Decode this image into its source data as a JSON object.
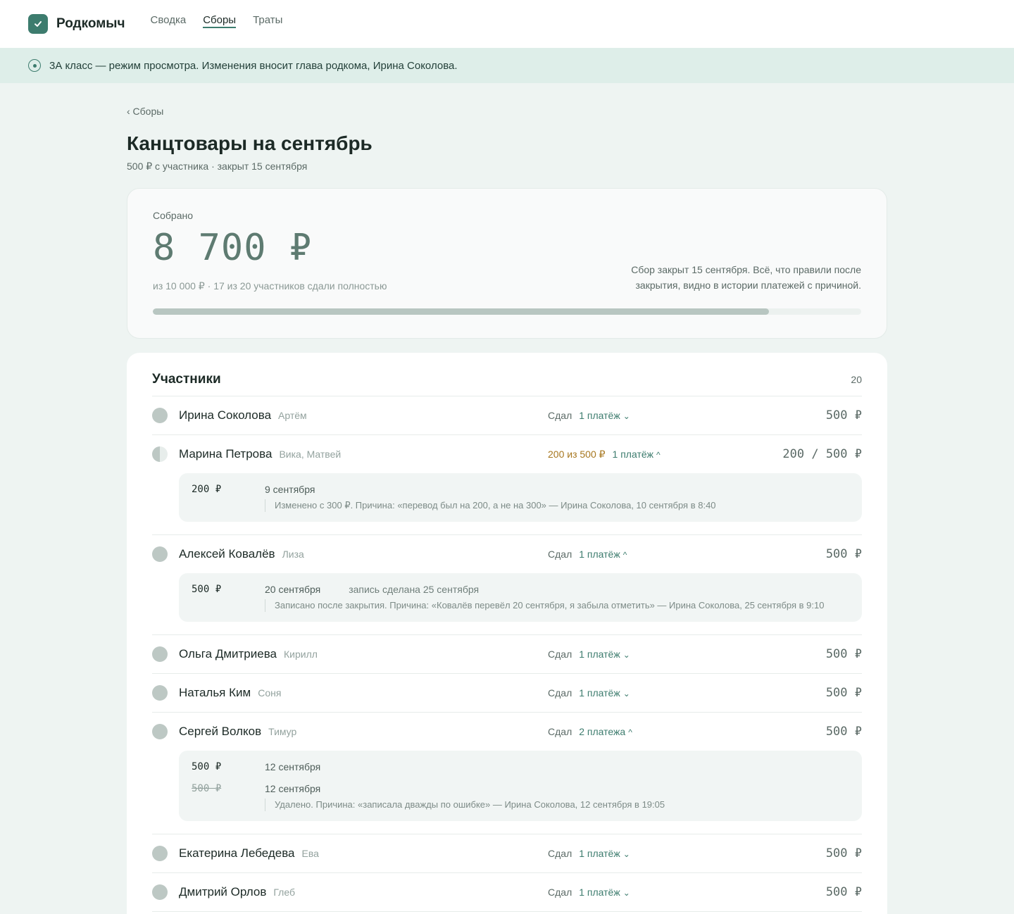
{
  "app": {
    "brand": "Родкомыч",
    "nav": [
      {
        "label": "Сводка",
        "active": false
      },
      {
        "label": "Сборы",
        "active": true
      },
      {
        "label": "Траты",
        "active": false
      }
    ]
  },
  "banner": {
    "text": "3А класс — режим просмотра. Изменения вносит глава родкома, Ирина Соколова."
  },
  "page": {
    "back_label": "‹ Сборы",
    "title": "Канцтовары на сентябрь",
    "subtitle": "500 ₽ с участника · закрыт 15 сентября"
  },
  "summary": {
    "label": "Собрано",
    "amount": "8 700 ₽",
    "sub": "из 10 000 ₽ · 17 из 20 участников сдали полностью",
    "note": "Сбор закрыт 15 сентября. Всё, что правили после закрытия, видно в истории платежей с причиной.",
    "progress": 0.87
  },
  "participants": {
    "title": "Участники",
    "count": "20",
    "rows": [
      {
        "name": "Ирина Соколова",
        "kids": "Артём",
        "status": "Сдал",
        "payments": "1 платёж",
        "chevron": "⌄",
        "amount": "500 ₽"
      },
      {
        "name": "Марина Петрова",
        "kids": "Вика, Матвей",
        "status": "200 из 500 ₽",
        "payments": "1 платёж",
        "chevron": "^",
        "amount": "200 / 500 ₽",
        "details": [
          {
            "amount": "200 ₽",
            "date": "9 сентября",
            "note": "Изменено с 300 ₽. Причина: «перевод был на 200, а не на 300» — Ирина Соколова, 10 сентября в 8:40"
          }
        ]
      },
      {
        "name": "Алексей Ковалёв",
        "kids": "Лиза",
        "status": "Сдал",
        "payments": "1 платёж",
        "chevron": "^",
        "amount": "500 ₽",
        "details": [
          {
            "amount": "500 ₽",
            "date": "20 сентября",
            "extra": "запись сделана 25 сентября",
            "note": "Записано после закрытия. Причина: «Ковалёв перевёл 20 сентября, я забыла отметить» — Ирина Соколова, 25 сентября в 9:10"
          }
        ]
      },
      {
        "name": "Ольга Дмитриева",
        "kids": "Кирилл",
        "status": "Сдал",
        "payments": "1 платёж",
        "chevron": "⌄",
        "amount": "500 ₽"
      },
      {
        "name": "Наталья Ким",
        "kids": "Соня",
        "status": "Сдал",
        "payments": "1 платёж",
        "chevron": "⌄",
        "amount": "500 ₽"
      },
      {
        "name": "Сергей Волков",
        "kids": "Тимур",
        "status": "Сдал",
        "payments": "2 платежа",
        "chevron": "^",
        "amount": "500 ₽",
        "details": [
          {
            "amount": "500 ₽",
            "date": "12 сентября"
          },
          {
            "amount": "500 ₽",
            "date": "12 сентября",
            "note": "Удалено. Причина: «записала дважды по ошибке» — Ирина Соколова, 12 сентября в 19:05"
          }
        ]
      },
      {
        "name": "Екатерина Лебедева",
        "kids": "Ева",
        "status": "Сдал",
        "payments": "1 платёж",
        "chevron": "⌄",
        "amount": "500 ₽"
      },
      {
        "name": "Дмитрий Орлов",
        "kids": "Глеб",
        "status": "Сдал",
        "payments": "1 платёж",
        "chevron": "⌄",
        "amount": "500 ₽"
      }
    ]
  },
  "colors": {
    "accent": "#3d7c6e",
    "partial": "#a7771f",
    "banner": "#deeee9"
  }
}
